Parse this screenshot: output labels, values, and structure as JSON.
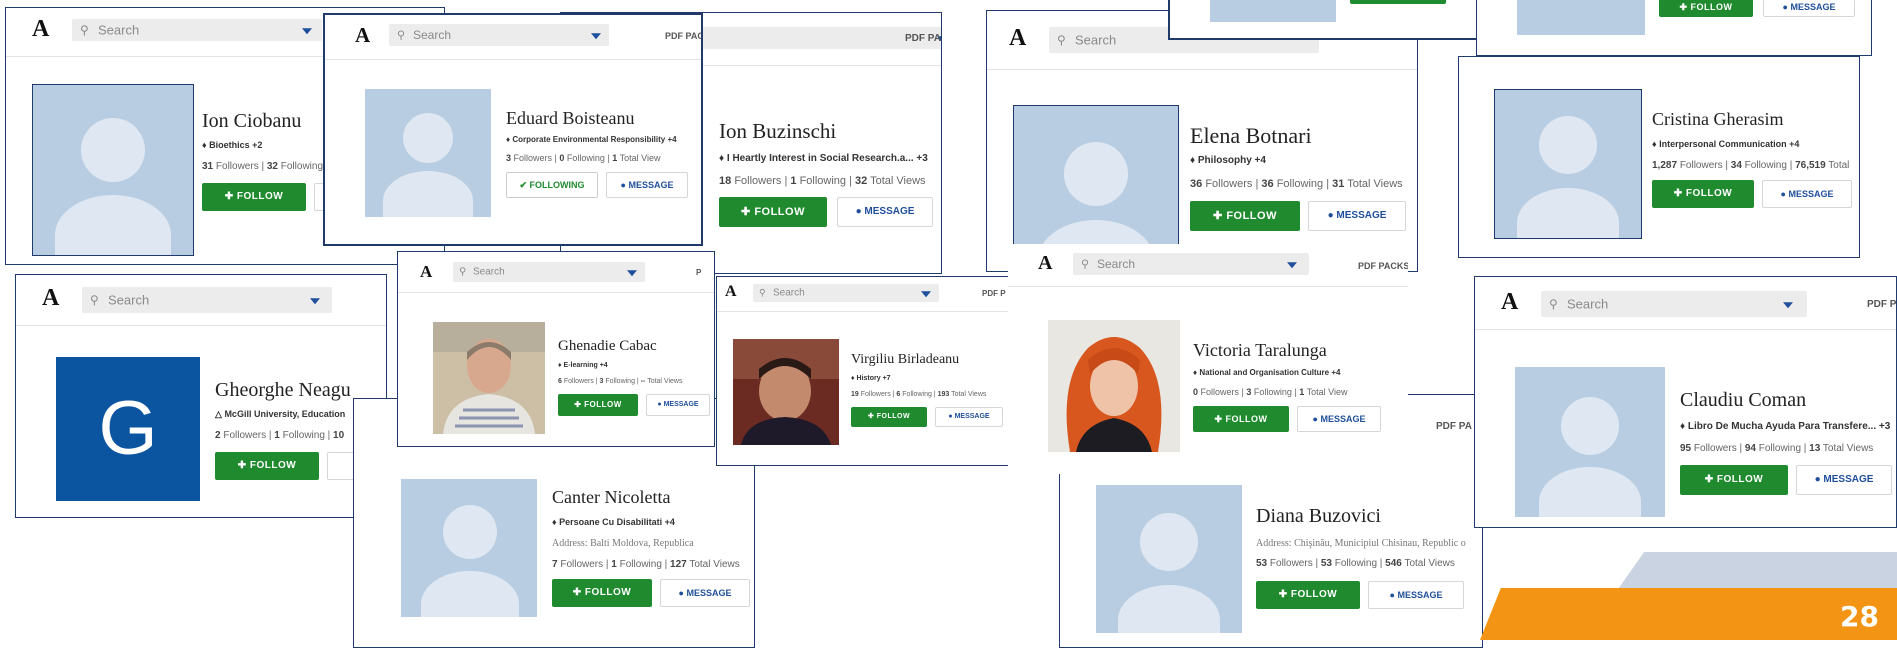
{
  "common": {
    "logo": "A",
    "search_placeholder": "Search",
    "pdf_packs": "PDF PACKS",
    "pdf_pack_cut": "PDF PACK",
    "pdf_pa_cut": "PDF PA",
    "follow": "FOLLOW",
    "following": "FOLLOWING",
    "message": "MESSAGE",
    "follow_icon": "plus-icon",
    "following_icon": "check-icon",
    "message_icon": "chat-bubble-icon",
    "tag_icon": "tag-icon",
    "institution_icon": "institution-icon"
  },
  "profiles": {
    "ion_ciobanu": {
      "name": "Ion Ciobanu",
      "tag": "Bioethics +2",
      "followers": "31",
      "following": "32",
      "followers_label": "Followers",
      "following_label": "Following"
    },
    "eduard_boisteanu": {
      "name": "Eduard Boisteanu",
      "tag": "Corporate Environmental Responsibility +4",
      "followers": "3",
      "following": "0",
      "views": "1",
      "followers_label": "Followers",
      "following_label": "Following",
      "views_label": "Total View"
    },
    "ion_buzinschi": {
      "name": "Ion Buzinschi",
      "tag": "I Heartly Interest in Social Research.a...",
      "tag_extra": "+3",
      "followers": "18",
      "following": "1",
      "views": "32",
      "followers_label": "Followers",
      "following_label": "Following",
      "views_label": "Total Views"
    },
    "elena_botnari": {
      "name": "Elena Botnari",
      "tag": "Philosophy +4",
      "followers": "36",
      "following": "36",
      "views": "31",
      "followers_label": "Followers",
      "following_label": "Following",
      "views_label": "Total Views"
    },
    "cristina_gherasim": {
      "name": "Cristina Gherasim",
      "tag": "Interpersonal Communication +4",
      "followers": "1,287",
      "following": "34",
      "views": "76,519",
      "followers_label": "Followers",
      "following_label": "Following",
      "views_label": "Total"
    },
    "gheorghe_neagu": {
      "name": "Gheorghe Neagu",
      "initial": "G",
      "tag": "McGill University, Education",
      "followers": "2",
      "following": "1",
      "views": "10",
      "followers_label": "Followers",
      "following_label": "Following"
    },
    "ghenadie_cabac": {
      "name": "Ghenadie Cabac",
      "tag": "E-learning +4",
      "followers": "6",
      "following": "3",
      "views": "--",
      "followers_label": "Followers",
      "following_label": "Following",
      "views_label": "Total Views"
    },
    "virgiliu_birladeanu": {
      "name": "Virgiliu Birladeanu",
      "tag": "History +7",
      "followers": "19",
      "following": "6",
      "views": "193",
      "followers_label": "Followers",
      "following_label": "Following",
      "views_label": "Total Views"
    },
    "victoria_taralunga": {
      "name": "Victoria Taralunga",
      "tag": "National and Organisation Culture +4",
      "followers": "0",
      "following": "3",
      "views": "1",
      "followers_label": "Followers",
      "following_label": "Following",
      "views_label": "Total View"
    },
    "claudiu_coman": {
      "name": "Claudiu Coman",
      "tag": "Libro De Mucha Ayuda Para Transfere...",
      "tag_extra": "+3",
      "followers": "95",
      "following": "94",
      "views": "13",
      "followers_label": "Followers",
      "following_label": "Following",
      "views_label": "Total Views"
    },
    "canter_nicoletta": {
      "name": "Canter Nicoletta",
      "tag": "Persoane Cu Disabilitati +4",
      "address_label": "Address:",
      "address": "Balti Moldova, Republica",
      "followers": "7",
      "following": "1",
      "views": "127",
      "followers_label": "Followers",
      "following_label": "Following",
      "views_label": "Total Views"
    },
    "diana_buzovici": {
      "name": "Diana Buzovici",
      "address_label": "Address:",
      "address": "Chişinău, Municipiul Chisinau, Republic o",
      "followers": "53",
      "following": "53",
      "views": "546",
      "followers_label": "Followers",
      "following_label": "Following",
      "views_label": "Total Views"
    }
  },
  "slide": {
    "page_number": "28"
  },
  "colors": {
    "follow_green": "#1f8a2e",
    "message_blue": "#1f4f9a",
    "avatar_bg": "#b9cde2",
    "frame_navy": "#1f3a6b",
    "footer_orange": "#f39414",
    "g_avatar_blue": "#0b55a0"
  }
}
